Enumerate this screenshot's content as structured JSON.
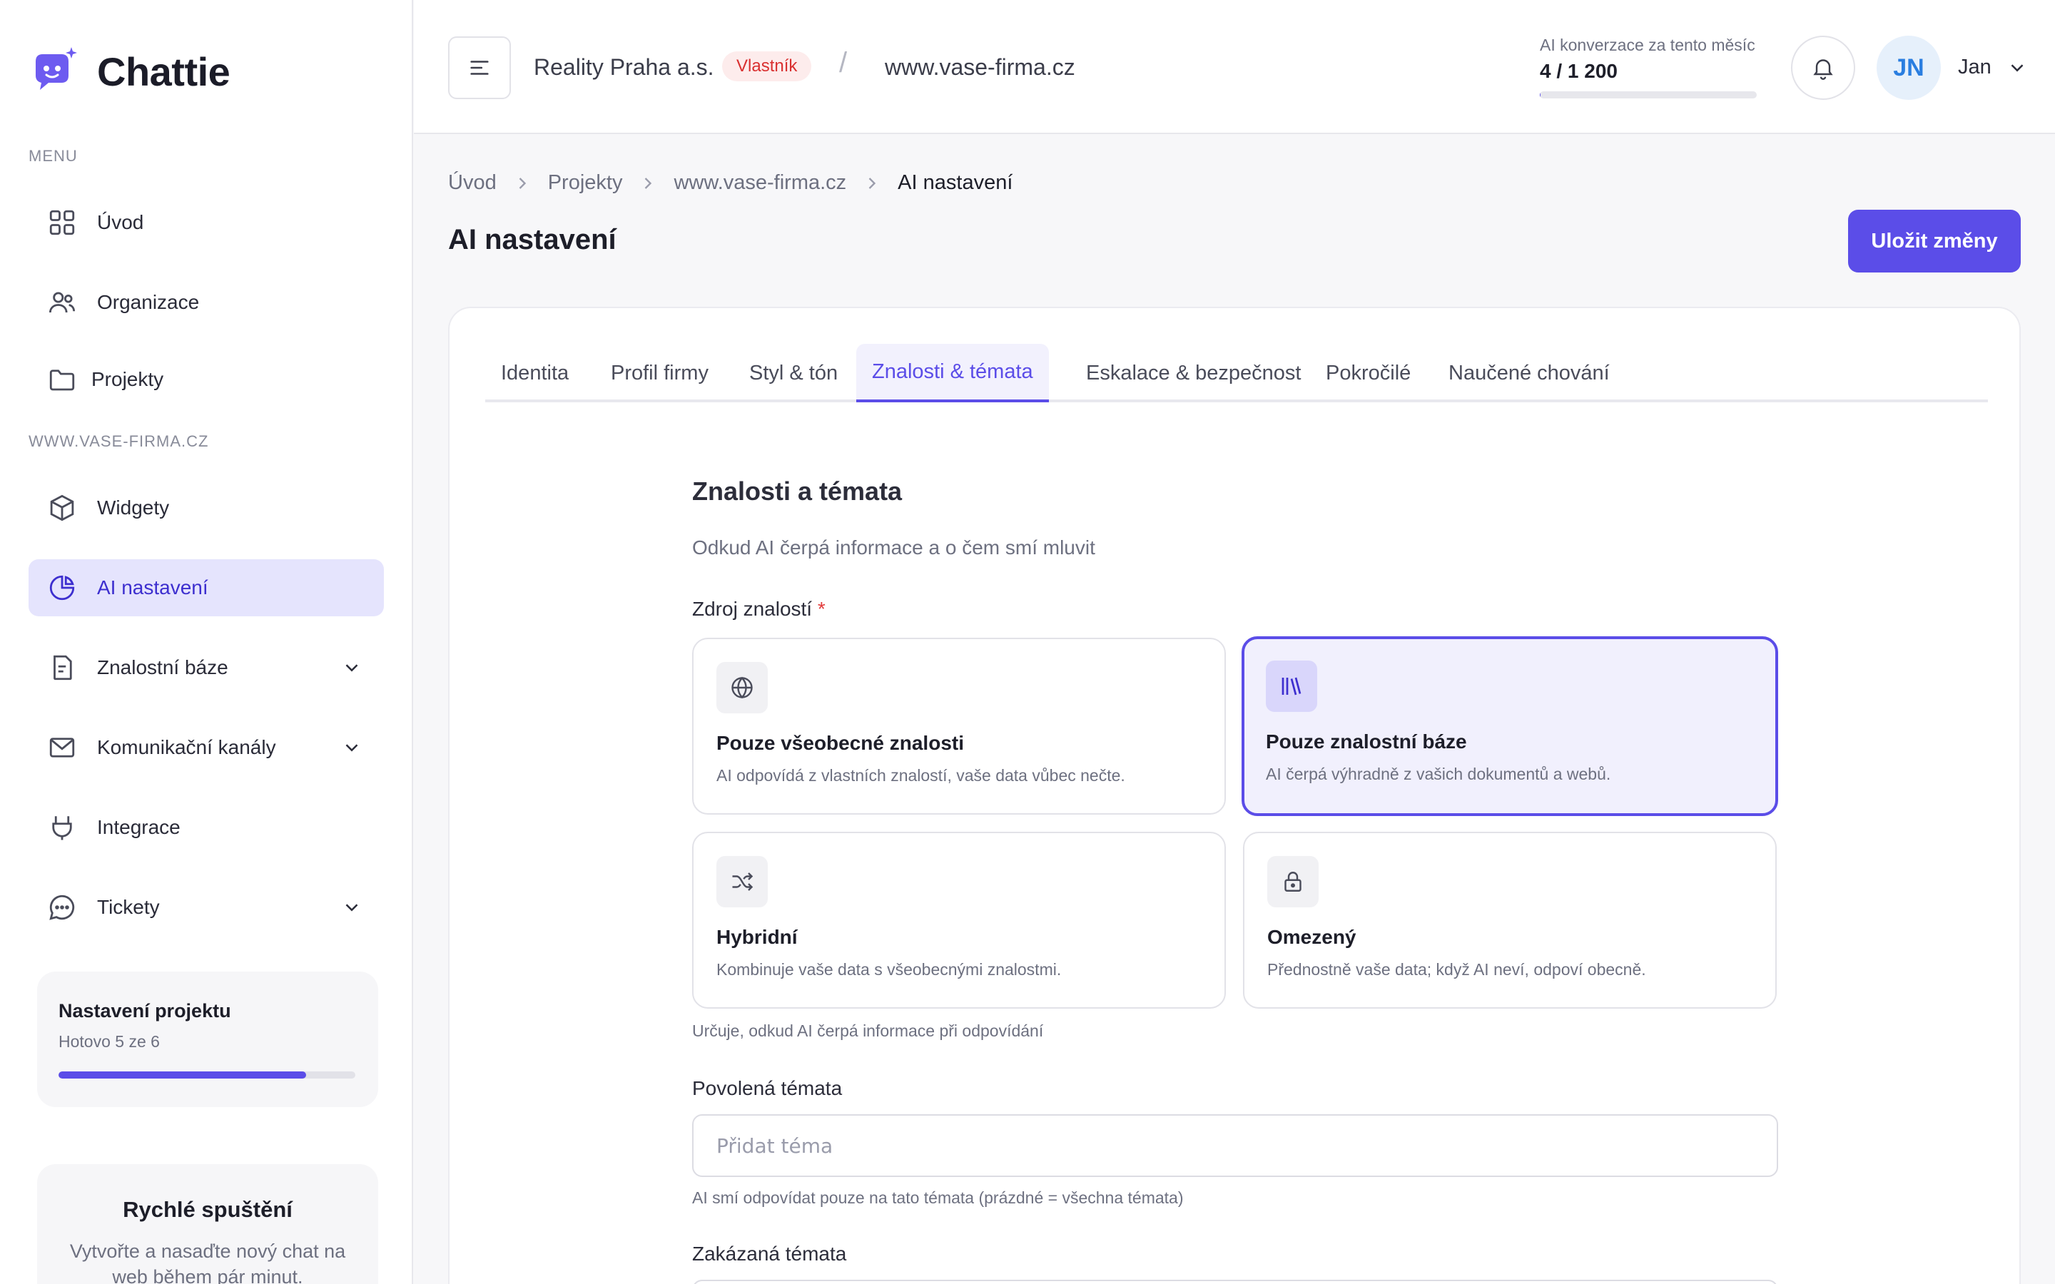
{
  "app": {
    "name": "Chattie"
  },
  "sidebar": {
    "menu_caption": "MENU",
    "project_caption": "WWW.VASE-FIRMA.CZ",
    "items": [
      {
        "label": "Úvod",
        "icon": "grid-icon"
      },
      {
        "label": "Organizace",
        "icon": "users-icon"
      },
      {
        "label": "Projekty",
        "icon": "folder-icon"
      },
      {
        "label": "Widgety",
        "icon": "cube-icon"
      },
      {
        "label": "AI nastavení",
        "icon": "pie-chart-icon",
        "active": true
      },
      {
        "label": "Znalostní báze",
        "icon": "document-icon",
        "expandable": true
      },
      {
        "label": "Komunikační kanály",
        "icon": "mail-icon",
        "expandable": true
      },
      {
        "label": "Integrace",
        "icon": "plug-icon"
      },
      {
        "label": "Tickety",
        "icon": "chat-bubble-icon",
        "expandable": true
      }
    ],
    "setup": {
      "title": "Nastavení projektu",
      "subtitle": "Hotovo 5 ze 6",
      "progress": 0.833
    },
    "quick_start": {
      "title": "Rychlé spuštění",
      "text": "Vytvořte a nasaďte nový chat na web během pár minut."
    }
  },
  "header": {
    "organization": "Reality Praha a.s.",
    "role_badge": "Vlastník",
    "separator": "/",
    "domain": "www.vase-firma.cz",
    "conversions_label": "AI konverzace za tento měsíc",
    "conversions_value": "4 / 1 200",
    "conversions_progress": 0.0033,
    "avatar_initials": "JN",
    "user_name": "Jan"
  },
  "breadcrumb": [
    "Úvod",
    "Projekty",
    "www.vase-firma.cz",
    "AI nastavení"
  ],
  "page": {
    "title": "AI nastavení",
    "save_label": "Uložit změny"
  },
  "tabs": [
    {
      "label": "Identita"
    },
    {
      "label": "Profil firmy"
    },
    {
      "label": "Styl & tón"
    },
    {
      "label": "Znalosti & témata",
      "active": true
    },
    {
      "label": "Eskalace & bezpečnost"
    },
    {
      "label": "Pokročilé"
    },
    {
      "label": "Naučené chování"
    }
  ],
  "knowledge": {
    "title": "Znalosti a témata",
    "description": "Odkud AI čerpá informace a o čem smí mluvit",
    "source_label": "Zdroj znalostí",
    "required_mark": "*",
    "options": [
      {
        "title": "Pouze všeobecné znalosti",
        "desc": "AI odpovídá z vlastních znalostí, vaše data vůbec nečte.",
        "icon": "globe-icon",
        "selected": false
      },
      {
        "title": "Pouze znalostní báze",
        "desc": "AI čerpá výhradně z vašich dokumentů a webů.",
        "icon": "library-icon",
        "selected": true
      },
      {
        "title": "Hybridní",
        "desc": "Kombinuje vaše data s všeobecnými znalostmi.",
        "icon": "shuffle-icon",
        "selected": false
      },
      {
        "title": "Omezený",
        "desc": "Přednostně vaše data; když AI neví, odpoví obecně.",
        "icon": "lock-icon",
        "selected": false
      }
    ],
    "source_hint": "Určuje, odkud AI čerpá informace při odpovídání",
    "allowed_label": "Povolená témata",
    "allowed_placeholder": "Přidat téma",
    "allowed_hint": "AI smí odpovídat pouze na tato témata (prázdné = všechna témata)",
    "forbidden_label": "Zakázaná témata"
  },
  "colors": {
    "accent": "#5b4de8",
    "active_nav_bg": "#e5e4fd",
    "badge_text": "#d93030",
    "badge_bg": "#fdecec"
  }
}
